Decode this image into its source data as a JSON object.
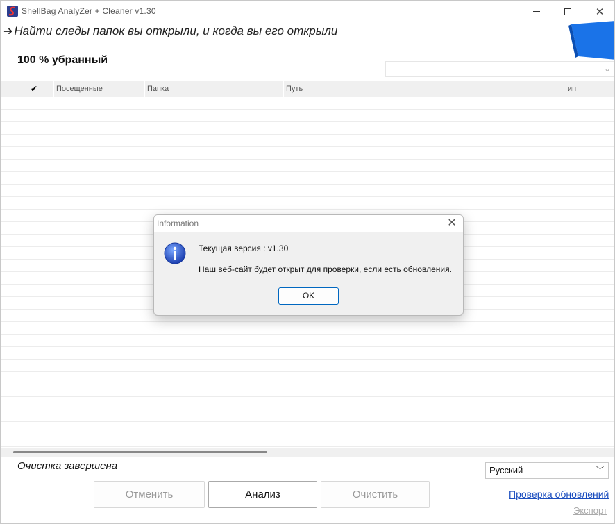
{
  "window": {
    "title": "ShellBag  AnalyZer + Cleaner v1.30",
    "minimize_icon": "minimize-icon",
    "maximize_icon": "maximize-icon",
    "close_icon": "close-icon"
  },
  "header": {
    "arrow": "➔",
    "headline": "Найти следы папок вы открыли, и когда вы его открыли",
    "progress_text": "100 % убранный"
  },
  "table": {
    "check_header": "✔",
    "columns": [
      "Посещенные",
      "Папка",
      "Путь",
      "тип"
    ],
    "rows": []
  },
  "footer": {
    "status": "Очистка завершена",
    "language": "Русский",
    "buttons": {
      "cancel": "Отменить",
      "analyze": "Анализ",
      "clean": "Очистить"
    },
    "check_updates": "Проверка обновлений",
    "export": "Экспорт"
  },
  "dialog": {
    "title": "Information",
    "version_label": "Текущая версия :  v1.30",
    "message": "Наш веб-сайт будет открыт для проверки, если есть обновления.",
    "ok": "OK",
    "icon": "info-icon"
  },
  "colors": {
    "accent": "#0067c0",
    "logo_blue": "#1a73e8",
    "link": "#1a4dbf",
    "disabled_text": "#999999"
  }
}
